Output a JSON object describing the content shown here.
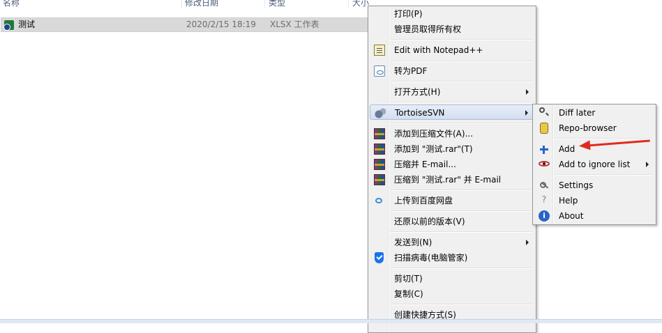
{
  "file_list": {
    "columns": [
      "名称",
      "修改日期",
      "类型",
      "大小"
    ],
    "rows": [
      {
        "name": "测试",
        "date": "2020/2/15 18:19",
        "type": "XLSX 工作表"
      }
    ]
  },
  "context_menu": {
    "items": [
      {
        "label": "打印(P)"
      },
      {
        "label": "管理员取得所有权"
      },
      {
        "label": "Edit with Notepad++",
        "icon": "notepad-icon"
      },
      {
        "label": "转为PDF",
        "icon": "pdf-icon"
      },
      {
        "label": "打开方式(H)",
        "submenu": true
      },
      {
        "label": "TortoiseSVN",
        "icon": "tortoisesvn-icon",
        "submenu": true,
        "highlighted": true
      },
      {
        "label": "添加到压缩文件(A)...",
        "icon": "winrar-icon"
      },
      {
        "label": "添加到 \"测试.rar\"(T)",
        "icon": "winrar-icon"
      },
      {
        "label": "压缩并 E-mail...",
        "icon": "winrar-icon"
      },
      {
        "label": "压缩到 \"测试.rar\" 并 E-mail",
        "icon": "winrar-icon"
      },
      {
        "label": "上传到百度网盘",
        "icon": "baidu-cloud-icon"
      },
      {
        "label": "还原以前的版本(V)"
      },
      {
        "label": "发送到(N)",
        "submenu": true
      },
      {
        "label": "扫描病毒(电脑管家)",
        "icon": "shield-icon"
      },
      {
        "label": "剪切(T)"
      },
      {
        "label": "复制(C)"
      },
      {
        "label": "创建快捷方式(S)"
      }
    ]
  },
  "svn_submenu": {
    "items": [
      {
        "label": "Diff later",
        "icon": "diff-search-icon"
      },
      {
        "label": "Repo-browser",
        "icon": "repo-browser-icon"
      },
      {
        "label": "Add",
        "icon": "add-plus-icon"
      },
      {
        "label": "Add to ignore list",
        "icon": "ignore-eye-icon",
        "submenu": true
      },
      {
        "label": "Settings",
        "icon": "settings-icon"
      },
      {
        "label": "Help",
        "icon": "help-icon"
      },
      {
        "label": "About",
        "icon": "about-icon"
      }
    ],
    "help_glyph": "?",
    "about_glyph": "i"
  },
  "colors": {
    "highlight": "#d3def0",
    "annotation_arrow": "#e12a1e",
    "menu_bg": "#f0f0f0"
  }
}
